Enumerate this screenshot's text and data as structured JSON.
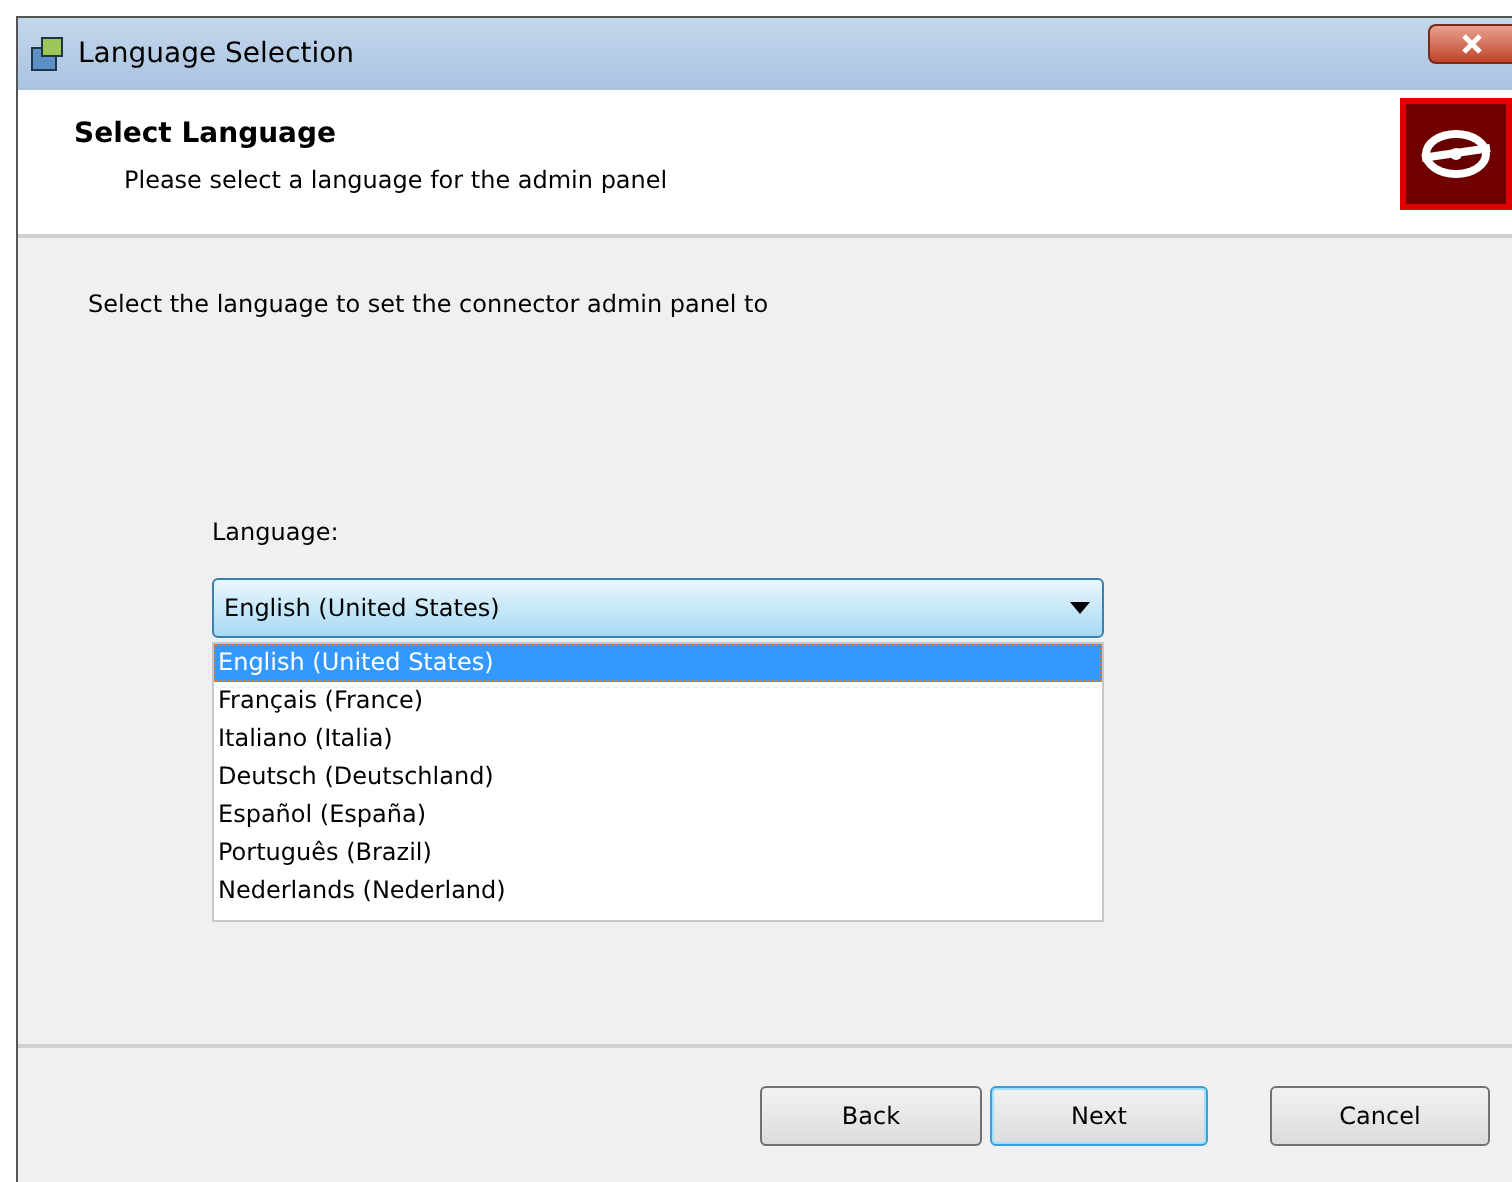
{
  "window": {
    "title": "Language Selection"
  },
  "header": {
    "title": "Select Language",
    "subtitle": "Please select a language for the admin panel"
  },
  "instruction": "Select the language to set the connector admin panel to",
  "language_field": {
    "label": "Language:",
    "value": "English (United States)",
    "expanded": true,
    "options": [
      {
        "label": "English (United States)",
        "selected": true
      },
      {
        "label": "Français (France)",
        "selected": false
      },
      {
        "label": "Italiano (Italia)",
        "selected": false
      },
      {
        "label": "Deutsch (Deutschland)",
        "selected": false
      },
      {
        "label": "Español (España)",
        "selected": false
      },
      {
        "label": "Português (Brazil)",
        "selected": false
      },
      {
        "label": "Nederlands (Nederland)",
        "selected": false
      }
    ]
  },
  "buttons": [
    {
      "label": "Back",
      "default": false
    },
    {
      "label": "Next",
      "default": true
    },
    {
      "label": "Cancel",
      "default": false
    }
  ]
}
